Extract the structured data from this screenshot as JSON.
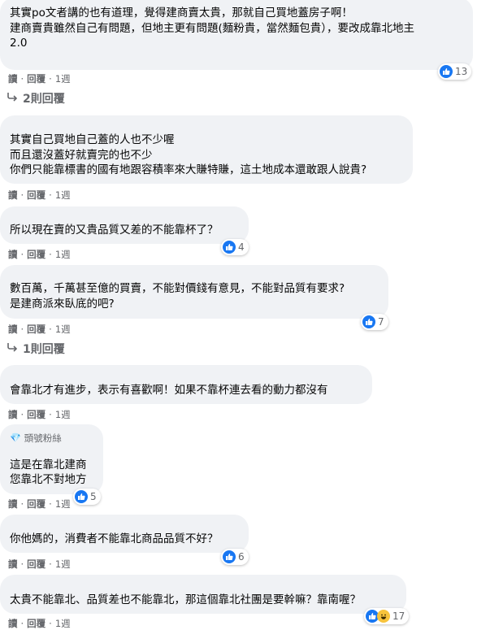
{
  "actions": {
    "read": "讀",
    "reply": "回覆",
    "sep": "·"
  },
  "comments": [
    {
      "lines": [
        "其實po文者講的也有道理，覺得建商賣太貴，那就自己買地蓋房子啊！",
        "建商賣貴雖然自己有問題，但地主更有問題(麵粉貴，當然麵包貴），要改成靠北地主",
        "2.0"
      ],
      "time": "1週",
      "reaction_count": "13",
      "replies": "2則回覆"
    },
    {
      "lines": [
        "其實自己買地自己蓋的人也不少喔",
        "而且還沒蓋好就賣完的也不少",
        "你們只能靠標書的國有地跟容積率來大賺特賺，這土地成本還敢跟人說貴?"
      ],
      "time": "1週"
    },
    {
      "lines": [
        "所以現在賣的又貴品質又差的不能靠杯了？"
      ],
      "time": "1週",
      "reaction_count": "4"
    },
    {
      "lines": [
        "數百萬，千萬甚至億的買賣，不能對價錢有意見，不能對品質有要求?",
        "是建商派來臥底的吧?"
      ],
      "time": "1週",
      "reaction_count": "7",
      "replies": "1則回覆"
    },
    {
      "lines": [
        "會靠北才有進步，表示有喜歡啊！如果不靠杯連去看的動力都沒有"
      ],
      "time": "1週"
    },
    {
      "badge": "頭號粉絲",
      "lines": [
        "這是在靠北建商",
        "您靠北不對地方"
      ],
      "time": "1週",
      "reaction_count": "5"
    },
    {
      "lines": [
        "你他媽的，消費者不能靠北商品品質不好？"
      ],
      "time": "1週",
      "reaction_count": "6"
    },
    {
      "lines": [
        "太貴不能靠北、品質差也不能靠北，那這個靠北社團是要幹嘛？靠南喔？"
      ],
      "time": "1週",
      "reaction_count": "17"
    }
  ],
  "colors": {
    "bubble": "#f0f2f5",
    "like": "#1877f2",
    "haha": "#f7c33c",
    "meta": "#65676b"
  }
}
